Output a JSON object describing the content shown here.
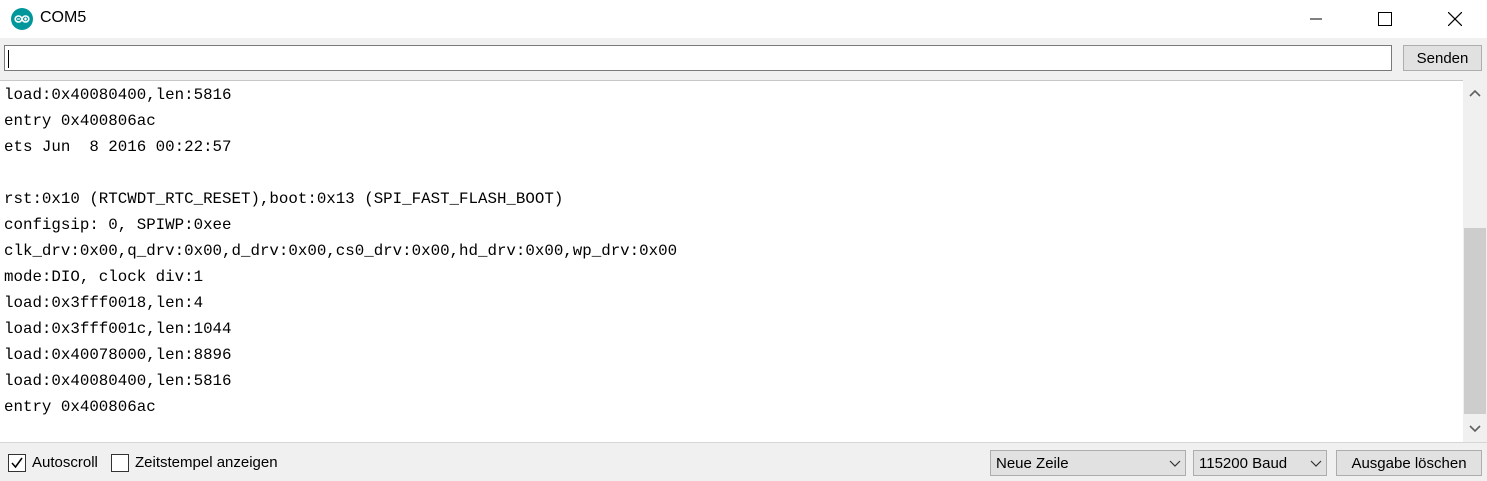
{
  "window": {
    "title": "COM5",
    "icon": "arduino-icon"
  },
  "send": {
    "input_value": "",
    "button_label": "Senden"
  },
  "output": {
    "lines": [
      "load:0x40080400,len:5816",
      "entry 0x400806ac",
      "ets Jun  8 2016 00:22:57",
      "",
      "rst:0x10 (RTCWDT_RTC_RESET),boot:0x13 (SPI_FAST_FLASH_BOOT)",
      "configsip: 0, SPIWP:0xee",
      "clk_drv:0x00,q_drv:0x00,d_drv:0x00,cs0_drv:0x00,hd_drv:0x00,wp_drv:0x00",
      "mode:DIO, clock div:1",
      "load:0x3fff0018,len:4",
      "load:0x3fff001c,len:1044",
      "load:0x40078000,len:8896",
      "load:0x40080400,len:5816",
      "entry 0x400806ac"
    ]
  },
  "footer": {
    "autoscroll_label": "Autoscroll",
    "autoscroll_checked": true,
    "timestamp_label": "Zeitstempel anzeigen",
    "timestamp_checked": false,
    "line_ending": "Neue Zeile",
    "baud": "115200 Baud",
    "clear_label": "Ausgabe löschen"
  },
  "colors": {
    "arduino_teal": "#00979c"
  }
}
